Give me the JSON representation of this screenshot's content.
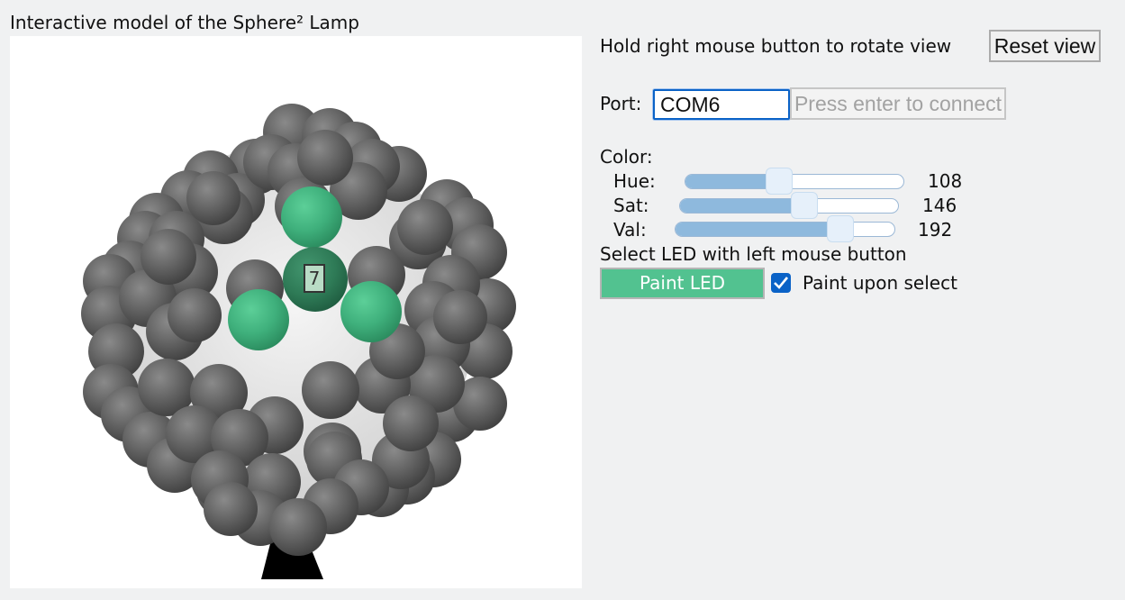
{
  "page": {
    "title": "Interactive model of the Sphere² Lamp"
  },
  "viewport": {
    "selected_led_number": "7",
    "led_colors": {
      "off": "#606060",
      "lit": "#3fb07c"
    }
  },
  "view": {
    "rotate_hint": "Hold right mouse button to rotate view",
    "reset_label": "Reset view"
  },
  "port": {
    "label": "Port:",
    "value": "COM6",
    "connect_label": "Press enter to connect"
  },
  "color": {
    "label": "Color:",
    "hue": {
      "label": "Hue:",
      "value": "108",
      "fraction": 0.43
    },
    "sat": {
      "label": "Sat:",
      "value": "146",
      "fraction": 0.57
    },
    "val": {
      "label": "Val:",
      "value": "192",
      "fraction": 0.75
    }
  },
  "select_hint": "Select LED with left mouse button",
  "paint": {
    "button_label": "Paint LED",
    "button_color": "#52c290",
    "checkbox_label": "Paint upon select",
    "checkbox_checked": true
  }
}
